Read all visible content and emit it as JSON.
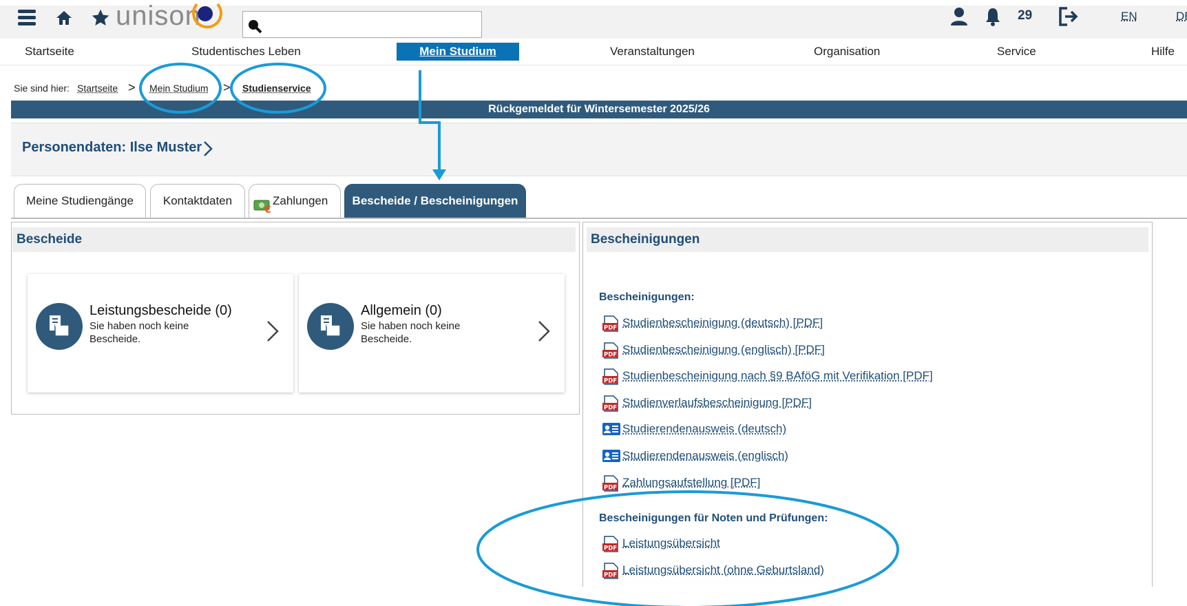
{
  "header": {
    "logo_text": "unison",
    "notification_count": "29",
    "lang_en": "EN",
    "lang_de": "DE"
  },
  "nav": {
    "items": [
      {
        "label": "Startseite"
      },
      {
        "label": "Studentisches Leben"
      },
      {
        "label": "Mein Studium"
      },
      {
        "label": "Veranstaltungen"
      },
      {
        "label": "Organisation"
      },
      {
        "label": "Service"
      },
      {
        "label": "Hilfe"
      }
    ]
  },
  "breadcrumb": {
    "prefix": "Sie sind hier:",
    "items": [
      "Startseite",
      "Mein Studium",
      "Studienservice"
    ]
  },
  "status": "Rückgemeldet für Wintersemester 2025/26",
  "person": {
    "title": "Personendaten: Ilse Muster"
  },
  "tabs": [
    "Meine Studiengänge",
    "Kontaktdaten",
    "Zahlungen",
    "Bescheide / Bescheinigungen"
  ],
  "bescheide": {
    "heading": "Bescheide",
    "cards": [
      {
        "title": "Leistungsbescheide (0)",
        "text": "Sie haben noch keine Bescheide."
      },
      {
        "title": "Allgemein (0)",
        "text": "Sie haben noch keine Bescheide."
      }
    ]
  },
  "bescheinigungen": {
    "heading": "Bescheinigungen",
    "section1_label": "Bescheinigungen:",
    "section1": [
      {
        "label": "Studienbescheinigung (deutsch) [PDF]",
        "icon": "pdf-icon"
      },
      {
        "label": "Studienbescheinigung (englisch) [PDF]",
        "icon": "pdf-icon"
      },
      {
        "label": "Studienbescheinigung nach §9 BAföG mit Verifikation [PDF]",
        "icon": "pdf-icon"
      },
      {
        "label": "Studienverlaufsbescheinigung [PDF]",
        "icon": "pdf-icon"
      },
      {
        "label": "Studierendenausweis (deutsch)",
        "icon": "id-card-icon"
      },
      {
        "label": "Studierendenausweis (englisch)",
        "icon": "id-card-icon"
      },
      {
        "label": "Zahlungsaufstellung [PDF]",
        "icon": "pdf-icon"
      }
    ],
    "section2_label": "Bescheinigungen für Noten und Prüfungen:",
    "section2": [
      {
        "label": "Leistungsübersicht",
        "icon": "pdf-icon"
      },
      {
        "label": "Leistungsübersicht (ohne Geburtsland)",
        "icon": "pdf-icon"
      }
    ]
  },
  "colors": {
    "primary": "#2f5a7c",
    "nav_active": "#0a72b5",
    "annotation": "#1a9bd7",
    "logo_accent": "#f39c12"
  }
}
